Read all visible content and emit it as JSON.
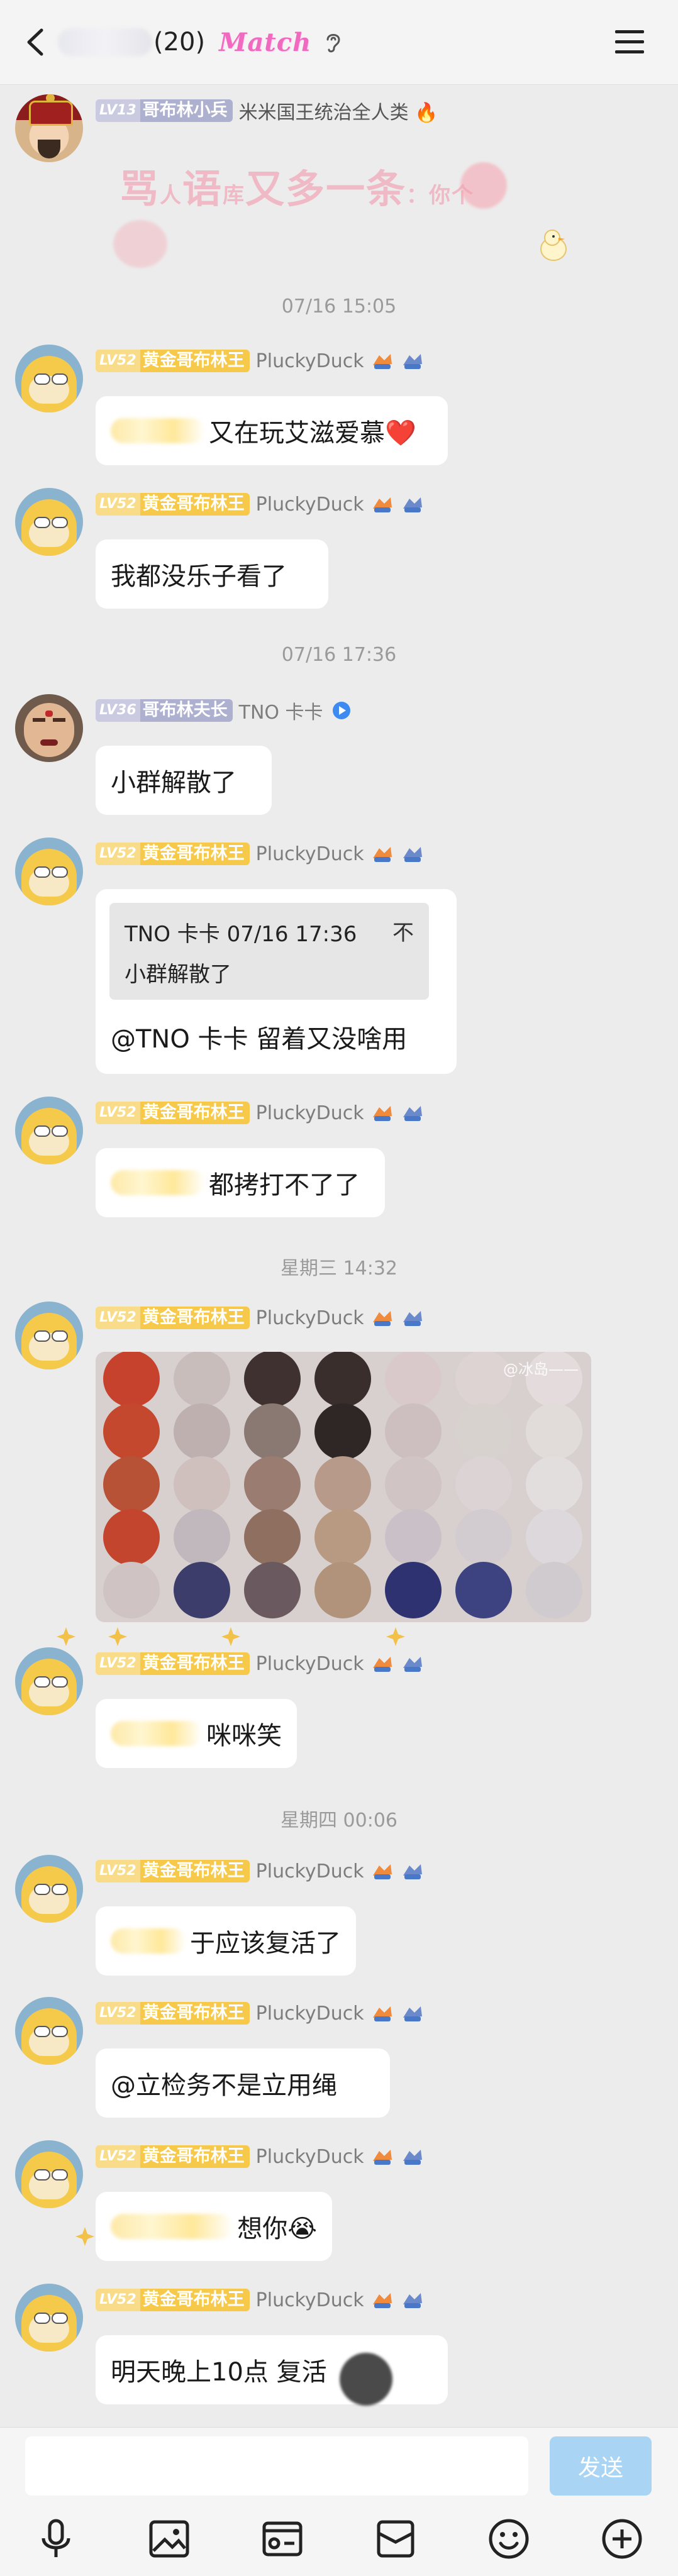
{
  "header": {
    "member_count": "(20)",
    "badge": "Match"
  },
  "pinned": {
    "badge_level": "LV13",
    "badge_title": "哥布林小兵",
    "announcement": "米米国王统治全人类 🔥",
    "banner_parts": [
      "骂",
      "人",
      "语",
      "库",
      "又多一条",
      "：你个"
    ]
  },
  "messages": [
    {
      "type": "time",
      "text": "07/16 15:05"
    },
    {
      "type": "text",
      "avatar": "duck",
      "level": "LV52",
      "title": "黄金哥布林王",
      "nick": "PluckyDuck",
      "text": "又在玩艾滋爱慕❤️",
      "obscured": true
    },
    {
      "type": "text",
      "avatar": "duck",
      "level": "LV52",
      "title": "黄金哥布林王",
      "nick": "PluckyDuck",
      "text": "我都没乐子看了"
    },
    {
      "type": "time",
      "text": "07/16 17:36"
    },
    {
      "type": "text",
      "avatar": "person",
      "level": "LV36",
      "title": "哥布林夫长",
      "nick": "TNO 卡卡",
      "text": "小群解散了"
    },
    {
      "type": "quote",
      "avatar": "duck",
      "level": "LV52",
      "title": "黄金哥布林王",
      "nick": "PluckyDuck",
      "quote_head": "TNO 卡卡 07/16 17:36",
      "quote_close": "不",
      "quote_body": "小群解散了",
      "text": "@TNO 卡卡 留着又没啥用"
    },
    {
      "type": "text",
      "avatar": "duck",
      "level": "LV52",
      "title": "黄金哥布林王",
      "nick": "PluckyDuck",
      "text": "都拷打不了了",
      "obscured": true
    },
    {
      "type": "time",
      "text": "星期三 14:32"
    },
    {
      "type": "image",
      "avatar": "duck",
      "level": "LV52",
      "title": "黄金哥布林王",
      "nick": "PluckyDuck",
      "watermark": "@冰岛——"
    },
    {
      "type": "text",
      "avatar": "duck",
      "level": "LV52",
      "title": "黄金哥布林王",
      "nick": "PluckyDuck",
      "text": "咪咪笑",
      "obscured": true
    },
    {
      "type": "time",
      "text": "星期四 00:06"
    },
    {
      "type": "text",
      "avatar": "duck",
      "level": "LV52",
      "title": "黄金哥布林王",
      "nick": "PluckyDuck",
      "text": "于应该复活了",
      "obscured": true
    },
    {
      "type": "text",
      "avatar": "duck",
      "level": "LV52",
      "title": "黄金哥布林王",
      "nick": "PluckyDuck",
      "text": "@立检务不是立用绳"
    },
    {
      "type": "text",
      "avatar": "duck",
      "level": "LV52",
      "title": "黄金哥布林王",
      "nick": "PluckyDuck",
      "text": "想你😭",
      "obscured": true
    },
    {
      "type": "text",
      "avatar": "duck",
      "level": "LV52",
      "title": "黄金哥布林王",
      "nick": "PluckyDuck",
      "text": "明天晚上10点 复活",
      "obscured": false
    }
  ],
  "composer": {
    "placeholder": "",
    "send_label": "发送"
  },
  "toolbar_icons": [
    "microphone-icon",
    "image-icon",
    "video-icon",
    "box-icon",
    "emoji-icon",
    "plus-icon"
  ],
  "colors": {
    "gold_badge": "#f6c94a",
    "lilac_badge": "#aeb0cf",
    "send_button": "#a9d4f3",
    "match": "#f06abf"
  }
}
